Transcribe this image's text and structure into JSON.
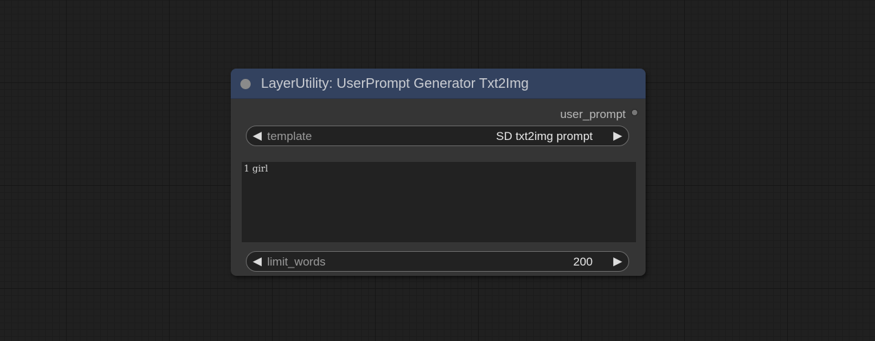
{
  "node": {
    "title": "LayerUtility: UserPrompt Generator Txt2Img",
    "output_label": "user_prompt",
    "template_widget": {
      "label": "template",
      "value": "SD txt2img prompt"
    },
    "prompt_text": "1 girl",
    "limit_words_widget": {
      "label": "limit_words",
      "value": "200"
    },
    "arrow_left": "◀",
    "arrow_right": "▶"
  },
  "colors": {
    "canvas_bg": "#202020",
    "node_bg": "#353535",
    "title_bg": "#33425f",
    "widget_bg": "#222222"
  },
  "icons": {
    "collapse": "collapse-dot-icon",
    "output": "output-slot-dot-icon",
    "decrement": "triangle-left-icon",
    "increment": "triangle-right-icon"
  }
}
